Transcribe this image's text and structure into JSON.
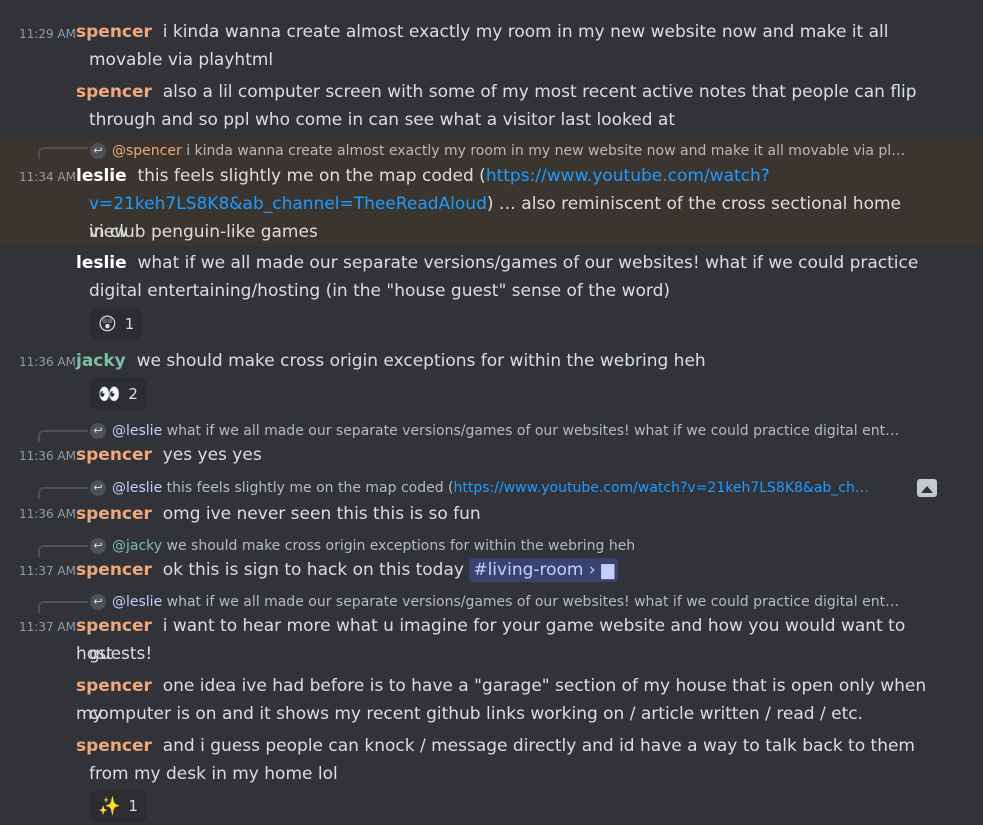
{
  "messages": [
    {
      "time": "11:29 AM",
      "author": "spencer",
      "line1": "i kinda wanna create almost exactly my room in my new website now and make it all",
      "line2": "movable via playhtml"
    },
    {
      "author": "spencer",
      "line1": "also a lil computer screen with some of my most recent active notes that people can flip",
      "line2": "through and so ppl who come in can see what a visitor last looked at"
    },
    {
      "reply_mention": "@spencer",
      "reply_preview": "i kinda wanna create almost exactly my room in my new website now and make it all movable via pl…",
      "time": "11:34 AM",
      "author": "leslie",
      "line1_prefix": "this feels slightly me on the map coded (",
      "line1_link": "https://www.youtube.com/watch?",
      "line2_link": "v=21keh7LS8K8&ab_channel=TheeReadAloud",
      "line2_suffix": ") … also reminiscent of the cross sectional home view",
      "line3": "in club penguin-like games"
    },
    {
      "author": "leslie",
      "line1": "what if we all made our separate versions/games of our websites! what if we could practice",
      "line2": "digital entertaining/hosting (in the \"house guest\" sense of the word)",
      "reaction_emoji": "😲",
      "reaction_count": "1"
    },
    {
      "time": "11:36 AM",
      "author": "jacky",
      "line1": "we should make cross origin exceptions for within the webring heh",
      "reaction_emoji": "👀",
      "reaction_count": "2"
    },
    {
      "reply_mention": "@leslie",
      "reply_preview": "what if we all made our separate versions/games of our websites! what if we could practice digital ent…",
      "time": "11:36 AM",
      "author": "spencer",
      "line1": "yes yes yes"
    },
    {
      "reply_mention": "@leslie",
      "reply_preview_prefix": "this feels slightly me on the map coded (",
      "reply_preview_link": "https://www.youtube.com/watch?v=21keh7LS8K8&ab_ch…",
      "time": "11:36 AM",
      "author": "spencer",
      "line1": "omg ive never seen this this is so fun"
    },
    {
      "reply_mention": "@jacky",
      "reply_preview": "we should make cross origin exceptions for within the webring heh",
      "time": "11:37 AM",
      "author": "spencer",
      "line1": "ok this is sign to hack on this today",
      "channel": "#living-room",
      "channel_chevron": "›"
    },
    {
      "reply_mention": "@leslie",
      "reply_preview": "what if we all made our separate versions/games of our websites! what if we could practice digital ent…",
      "time": "11:37 AM",
      "author": "spencer",
      "line1": "i want to hear more what u imagine for your game website and how you would want to host",
      "line2": "guests!"
    },
    {
      "author": "spencer",
      "line1": "one idea ive had before is to have a \"garage\" section of my house that is open only when my",
      "line2": "computer is on and it shows my recent github links working on / article written / read / etc."
    },
    {
      "author": "spencer",
      "line1": "and i guess people can knock / message directly and id have a way to talk back to them",
      "line2": "from my desk in my home lol",
      "reaction_emoji": "✨",
      "reaction_count": "1"
    }
  ],
  "icons": {
    "reply": "reply-arrow-icon",
    "image": "image-icon",
    "thread": "thread-icon"
  },
  "colors": {
    "background": "#313338",
    "spencer": "#f0a77a",
    "jacky": "#7dbfa3",
    "leslie": "#ffffff",
    "link": "#1e9bff",
    "highlight": "#3b3530"
  }
}
